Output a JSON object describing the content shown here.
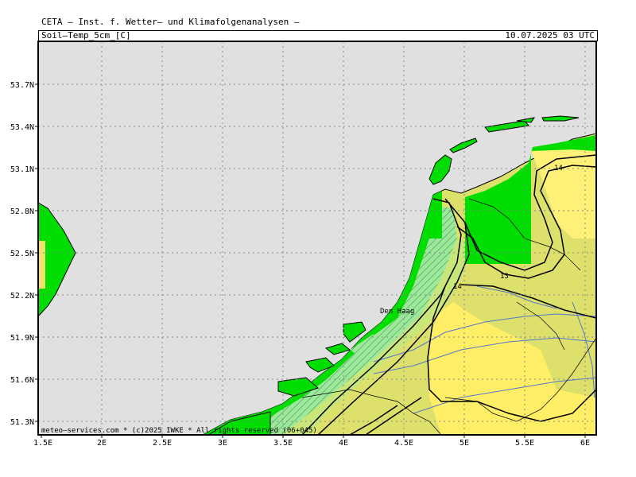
{
  "header": {
    "title": "CETA — Inst. f. Wetter— und Klimafolgenanalysen —",
    "parameter": "Soil—Temp_5cm_[C]",
    "datetime": "10.07.2025 03 UTC"
  },
  "axes": {
    "lon_labels": [
      "1.5E",
      "2E",
      "2.5E",
      "3E",
      "3.5E",
      "4E",
      "4.5E",
      "5E",
      "5.5E",
      "6E"
    ],
    "lat_labels": [
      "51.3N",
      "51.6N",
      "51.9N",
      "52.2N",
      "52.5N",
      "52.8N",
      "53.1N",
      "53.4N",
      "53.7N"
    ]
  },
  "map": {
    "place_label": "Den Haag",
    "contour_labels": [
      "14",
      "14",
      "13",
      "14"
    ],
    "colors": {
      "sea": "#e0e0e0",
      "green": "#00dd00",
      "light_green": "#9ee89e",
      "yellow_green": "#dde06a",
      "pale_yellow": "#f0f06a",
      "yellow": "#ffee66",
      "river": "#5577cc"
    }
  },
  "footer": {
    "credit": "meteo—services.com * (c)2025 IWKE * All rights reserved (06+045)"
  }
}
